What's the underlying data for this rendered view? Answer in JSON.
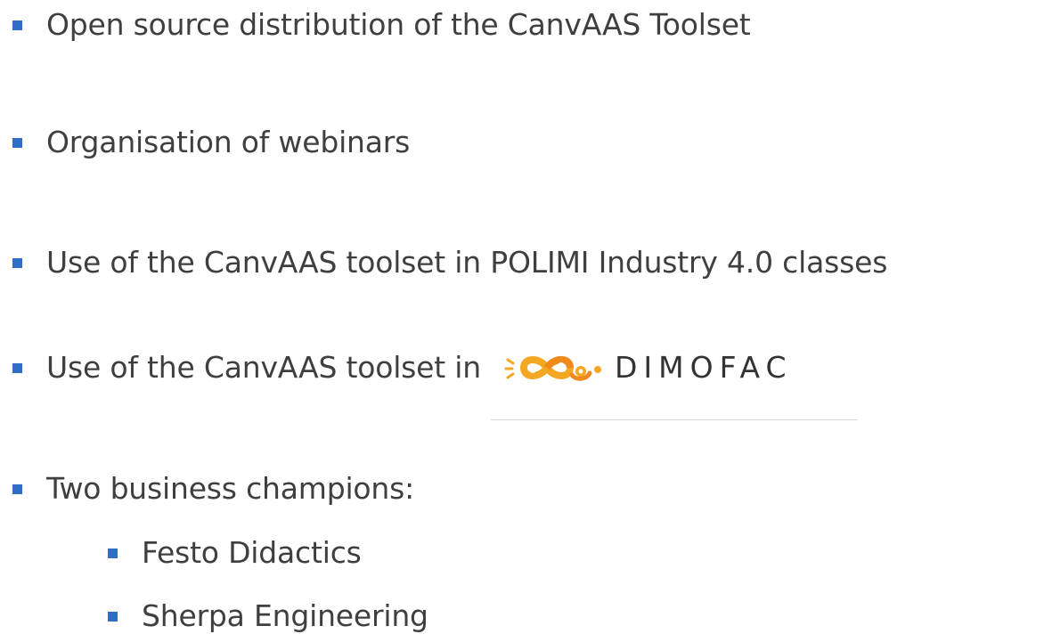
{
  "bullets": [
    {
      "text": "Open source distribution of the CanvAAS Toolset"
    },
    {
      "text": "Organisation of webinars"
    },
    {
      "text": "Use of the CanvAAS toolset in POLIMI Industry 4.0 classes"
    },
    {
      "text": "Use of the CanvAAS toolset in",
      "logo": {
        "word": "DIMOFAC",
        "icon": "dimofac-logo-icon"
      }
    },
    {
      "text": "Two business champions:",
      "sub": [
        {
          "text": "Festo Didactics"
        },
        {
          "text": "Sherpa Engineering"
        }
      ]
    }
  ],
  "colors": {
    "bullet": "#2f6ec4",
    "text": "#3f3f3f",
    "logo_orange": "#f5a623",
    "logo_orange_dark": "#f08a1c"
  }
}
